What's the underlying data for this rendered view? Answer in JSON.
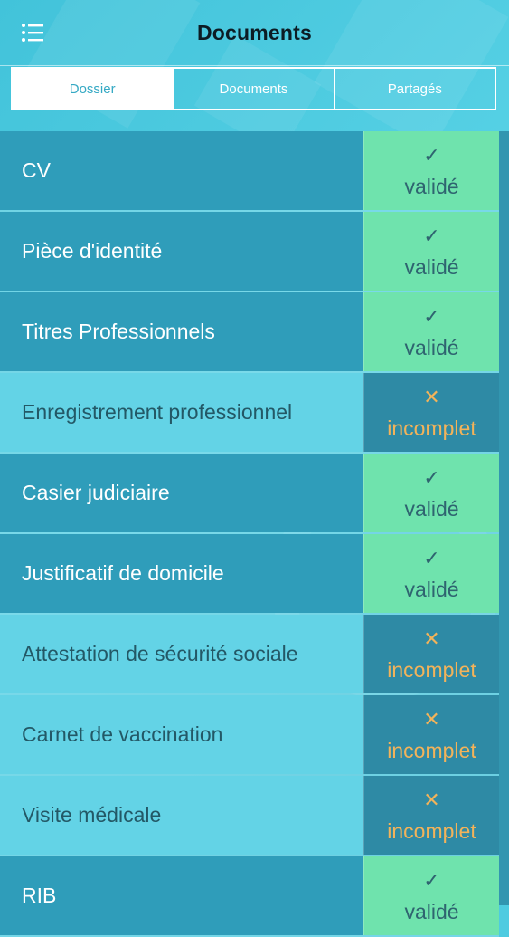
{
  "header": {
    "title": "Documents",
    "menu_icon": "list-menu-icon"
  },
  "tabs": [
    {
      "label": "Dossier",
      "active": true
    },
    {
      "label": "Documents",
      "active": false
    },
    {
      "label": "Partagés",
      "active": false
    }
  ],
  "status_labels": {
    "valid": "validé",
    "incomplete": "incomplet"
  },
  "status_glyphs": {
    "valid": "✓",
    "incomplete": "✕"
  },
  "documents": [
    {
      "name": "CV",
      "status": "validé",
      "glyph": "✓"
    },
    {
      "name": "Pièce d'identité",
      "status": "validé",
      "glyph": "✓"
    },
    {
      "name": "Titres Professionnels",
      "status": "validé",
      "glyph": "✓"
    },
    {
      "name": "Enregistrement professionnel",
      "status": "incomplet",
      "glyph": "✕"
    },
    {
      "name": "Casier judiciaire",
      "status": "validé",
      "glyph": "✓"
    },
    {
      "name": "Justificatif de domicile",
      "status": "validé",
      "glyph": "✓"
    },
    {
      "name": "Attestation de sécurité sociale",
      "status": "incomplet",
      "glyph": "✕"
    },
    {
      "name": "Carnet de vaccination",
      "status": "incomplet",
      "glyph": "✕"
    },
    {
      "name": "Visite médicale",
      "status": "incomplet",
      "glyph": "✕"
    },
    {
      "name": "RIB",
      "status": "validé",
      "glyph": "✓"
    }
  ],
  "colors": {
    "valid_status_bg": "#6fe3ad",
    "incomplete_status_bg": "#2e8aa5",
    "incomplete_text": "#f2b35a",
    "valid_row_bg": "#2f9dba",
    "incomplete_row_bg": "#63d3e6"
  }
}
